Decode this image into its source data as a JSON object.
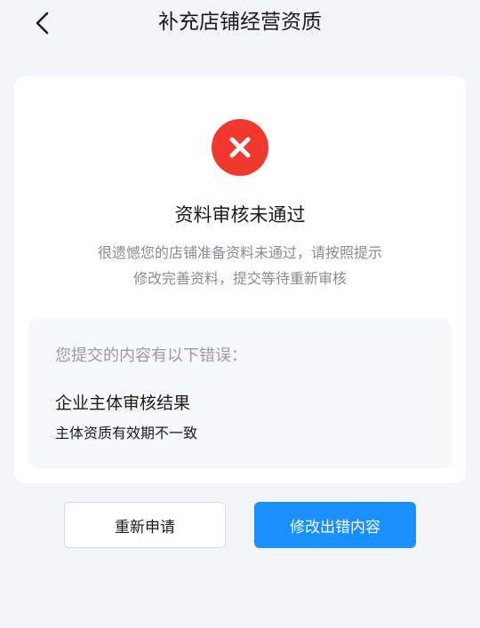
{
  "header": {
    "title": "补充店铺经营资质",
    "back_icon": "chevron-left-icon"
  },
  "status": {
    "icon": "error-x-icon",
    "color": "#f0382f",
    "title": "资料审核未通过",
    "description_line1": "很遗憾您的店铺准备资料未通过，请按照提示",
    "description_line2": "修改完善资料，提交等待重新审核"
  },
  "errors": {
    "heading": "您提交的内容有以下错误：",
    "items": [
      {
        "title": "企业主体审核结果",
        "detail": "主体资质有效期不一致"
      }
    ]
  },
  "actions": {
    "reapply_label": "重新申请",
    "edit_label": "修改出错内容",
    "primary_color": "#1890ff"
  }
}
